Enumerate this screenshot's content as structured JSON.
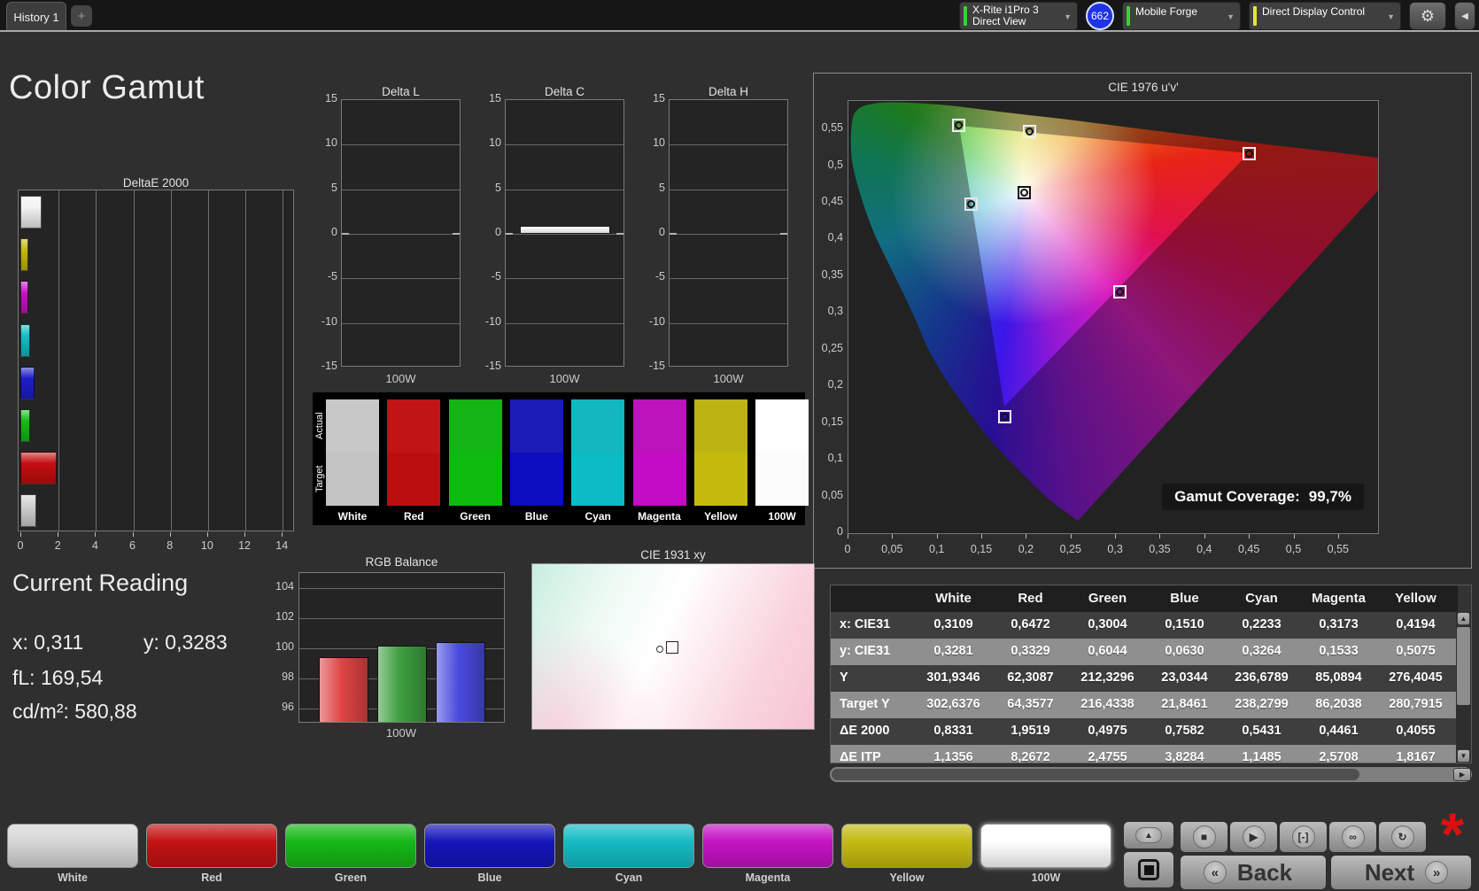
{
  "titlebar": {
    "tab": "History 1",
    "add_tab": "+",
    "meter": {
      "line1": "X-Rite i1Pro 3",
      "line2": "Direct View",
      "stripe": "#35d435"
    },
    "badge": "662",
    "workflow": {
      "label": "Mobile Forge",
      "stripe": "#35d435"
    },
    "control": {
      "label": "Direct Display Control",
      "stripe": "#e6e62e"
    },
    "gear_icon": "⚙",
    "collapse_icon": "◀",
    "chevron": "▼"
  },
  "page_title": "Color Gamut",
  "deltae_chart": {
    "title": "DeltaE 2000",
    "x_ticks": [
      0,
      2,
      4,
      6,
      8,
      10,
      12,
      14
    ],
    "x_max": 14.7,
    "bars": [
      {
        "name": "100W",
        "value": 1.14,
        "color": "#f2f2f2"
      },
      {
        "name": "Yellow",
        "value": 0.41,
        "color": "#c2b812"
      },
      {
        "name": "Magenta",
        "value": 0.45,
        "color": "#c414c4"
      },
      {
        "name": "Cyan",
        "value": 0.54,
        "color": "#14bcc4"
      },
      {
        "name": "Blue",
        "value": 0.76,
        "color": "#1d1dc9"
      },
      {
        "name": "Green",
        "value": 0.5,
        "color": "#17bb17"
      },
      {
        "name": "Red",
        "value": 1.95,
        "color": "#c40e0e"
      },
      {
        "name": "White",
        "value": 0.83,
        "color": "#d0d0d0"
      }
    ]
  },
  "delta_charts": [
    {
      "title": "Delta L",
      "x_label": "100W",
      "bar_value": 0
    },
    {
      "title": "Delta C",
      "x_label": "100W",
      "bar_value": 0.85
    },
    {
      "title": "Delta H",
      "x_label": "100W",
      "bar_value": 0
    }
  ],
  "delta_y_ticks": [
    15,
    10,
    5,
    0,
    -5,
    -10,
    -15
  ],
  "swatch_strip": {
    "row_labels": [
      "Actual",
      "Target"
    ],
    "columns": [
      {
        "label": "White",
        "actual": "#c8c8c8",
        "target": "#c3c3c3"
      },
      {
        "label": "Red",
        "actual": "#c11414",
        "target": "#bb0e0e"
      },
      {
        "label": "Green",
        "actual": "#13b413",
        "target": "#0fba0f"
      },
      {
        "label": "Blue",
        "actual": "#1b1bb8",
        "target": "#0c0cc1"
      },
      {
        "label": "Cyan",
        "actual": "#12b7bf",
        "target": "#0cbcc4"
      },
      {
        "label": "Magenta",
        "actual": "#bd13bd",
        "target": "#c40cc4"
      },
      {
        "label": "Yellow",
        "actual": "#bdb313",
        "target": "#c4ba0c"
      },
      {
        "label": "100W",
        "actual": "#ffffff",
        "target": "#fcfcfc"
      }
    ]
  },
  "cie1976": {
    "title": "CIE 1976 u'v'",
    "y_tick_labels": [
      "0,55",
      "0,5",
      "0,45",
      "0,4",
      "0,35",
      "0,3",
      "0,25",
      "0,2",
      "0,15",
      "0,1",
      "0,05",
      "0"
    ],
    "x_tick_labels": [
      "0",
      "0,05",
      "0,1",
      "0,15",
      "0,2",
      "0,25",
      "0,3",
      "0,35",
      "0,4",
      "0,45",
      "0,5",
      "0,55"
    ],
    "coverage_label": "Gamut Coverage:",
    "coverage_value": "99,7%",
    "markers": [
      {
        "name": "green",
        "u": 0.124,
        "v": 0.555,
        "frame": "#f0f0f0"
      },
      {
        "name": "yellow",
        "u": 0.203,
        "v": 0.547,
        "frame": "#f0f0f0"
      },
      {
        "name": "red",
        "u": 0.449,
        "v": 0.517,
        "frame": "#f0f0f0"
      },
      {
        "name": "white",
        "u": 0.197,
        "v": 0.464,
        "frame": "#111111"
      },
      {
        "name": "cyan",
        "u": 0.138,
        "v": 0.448,
        "frame": "#e8e8e8"
      },
      {
        "name": "magenta",
        "u": 0.304,
        "v": 0.329,
        "frame": "#f0f0f0"
      },
      {
        "name": "blue",
        "u": 0.175,
        "v": 0.159,
        "frame": "#f0f0f0"
      }
    ]
  },
  "current_reading": {
    "title": "Current Reading",
    "x": "x: 0,311",
    "y": "y: 0,3283",
    "fl": "fL: 169,54",
    "cd": "cd/m²: 580,88"
  },
  "rgb_balance": {
    "title": "RGB Balance",
    "x_label": "100W",
    "y_ticks": [
      104,
      102,
      100,
      98,
      96
    ],
    "y_top": 105,
    "bars": [
      {
        "name": "red",
        "value": 99.4,
        "color": "#e04444"
      },
      {
        "name": "green",
        "value": 100.15,
        "color": "#3f9f3f"
      },
      {
        "name": "blue",
        "value": 100.4,
        "color": "#4a4ae0"
      }
    ]
  },
  "cie1931": {
    "title": "CIE 1931 xy"
  },
  "results_table": {
    "columns": [
      "White",
      "Red",
      "Green",
      "Blue",
      "Cyan",
      "Magenta",
      "Yellow"
    ],
    "rows": [
      {
        "label": "x: CIE31",
        "values": [
          "0,3109",
          "0,6472",
          "0,3004",
          "0,1510",
          "0,2233",
          "0,3173",
          "0,4194"
        ]
      },
      {
        "label": "y: CIE31",
        "values": [
          "0,3281",
          "0,3329",
          "0,6044",
          "0,0630",
          "0,3264",
          "0,1533",
          "0,5075"
        ]
      },
      {
        "label": "Y",
        "values": [
          "301,9346",
          "62,3087",
          "212,3296",
          "23,0344",
          "236,6789",
          "85,0894",
          "276,4045"
        ]
      },
      {
        "label": "Target Y",
        "values": [
          "302,6376",
          "64,3577",
          "216,4338",
          "21,8461",
          "238,2799",
          "86,2038",
          "280,7915"
        ]
      },
      {
        "label": "ΔE 2000",
        "values": [
          "0,8331",
          "1,9519",
          "0,4975",
          "0,7582",
          "0,5431",
          "0,4461",
          "0,4055"
        ]
      },
      {
        "label": "ΔE ITP",
        "values": [
          "1,1356",
          "8,2672",
          "2,4755",
          "3,8284",
          "1,1485",
          "2,5708",
          "1,8167"
        ]
      }
    ],
    "scroll_up_icon": "▲",
    "scroll_down_icon": "▼",
    "scroll_right_icon": "▶"
  },
  "bottom_bar": {
    "patches": [
      {
        "label": "White",
        "color": "#d6d6d6",
        "selected": false
      },
      {
        "label": "Red",
        "color": "#c31212",
        "selected": false
      },
      {
        "label": "Green",
        "color": "#15b815",
        "selected": false
      },
      {
        "label": "Blue",
        "color": "#1515bb",
        "selected": false
      },
      {
        "label": "Cyan",
        "color": "#15bbc4",
        "selected": false
      },
      {
        "label": "Magenta",
        "color": "#c413c4",
        "selected": false
      },
      {
        "label": "Yellow",
        "color": "#c4ba12",
        "selected": false
      },
      {
        "label": "100W",
        "color": "#ffffff",
        "selected": true
      }
    ],
    "transport": [
      {
        "name": "stop-button",
        "glyph": "■"
      },
      {
        "name": "play-button",
        "glyph": "▶"
      },
      {
        "name": "range-button",
        "glyph": "[-]"
      },
      {
        "name": "loop-button",
        "glyph": "∞"
      },
      {
        "name": "refresh-button",
        "glyph": "↻"
      }
    ],
    "up_icon": "▲",
    "back_label": "Back",
    "next_label": "Next",
    "back_icon": "«",
    "next_icon": "»",
    "alert_icon": "*"
  }
}
